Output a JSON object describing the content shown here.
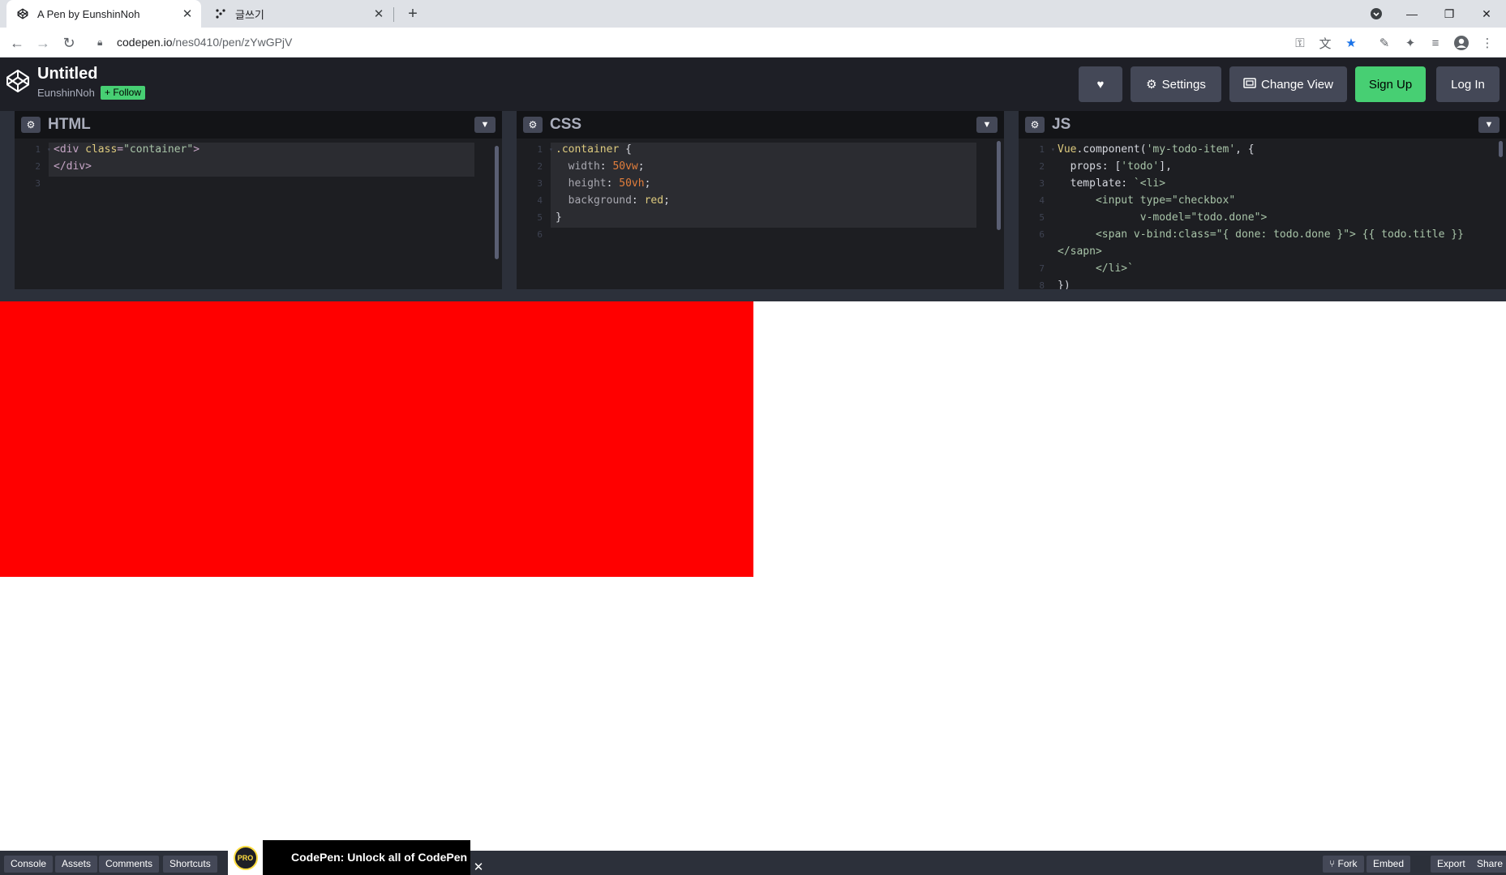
{
  "browser": {
    "tabs": [
      {
        "title": "A Pen by EunshinNoh",
        "icon": "codepen-icon",
        "active": true
      },
      {
        "title": "글쓰기",
        "icon": "dots-icon",
        "active": false
      }
    ],
    "url_host": "codepen.io",
    "url_path": "/nes0410/pen/zYwGPjV"
  },
  "header": {
    "pen_title": "Untitled",
    "author": "EunshinNoh",
    "follow_label": "+ Follow",
    "settings_label": "Settings",
    "change_view_label": "Change View",
    "sign_up_label": "Sign Up",
    "log_in_label": "Log In"
  },
  "editors": {
    "html": {
      "label": "HTML",
      "lines": [
        [
          {
            "t": "<div ",
            "c": "t-tag"
          },
          {
            "t": "class",
            "c": "t-attr"
          },
          {
            "t": "=",
            "c": "t-tag"
          },
          {
            "t": "\"container\"",
            "c": "t-str"
          },
          {
            "t": ">",
            "c": "t-tag"
          }
        ],
        [
          {
            "t": "</div>",
            "c": "t-tag"
          }
        ],
        []
      ]
    },
    "css": {
      "label": "CSS",
      "lines": [
        [
          {
            "t": ".container",
            "c": "t-sel"
          },
          {
            "t": " {",
            "c": "t-id"
          }
        ],
        [
          {
            "t": "  width",
            "c": "t-prop"
          },
          {
            "t": ": ",
            "c": "t-id"
          },
          {
            "t": "50vw",
            "c": "t-num"
          },
          {
            "t": ";",
            "c": "t-id"
          }
        ],
        [
          {
            "t": "  height",
            "c": "t-prop"
          },
          {
            "t": ": ",
            "c": "t-id"
          },
          {
            "t": "50vh",
            "c": "t-num"
          },
          {
            "t": ";",
            "c": "t-id"
          }
        ],
        [
          {
            "t": "  background",
            "c": "t-prop"
          },
          {
            "t": ": ",
            "c": "t-id"
          },
          {
            "t": "red",
            "c": "t-val"
          },
          {
            "t": ";",
            "c": "t-id"
          }
        ],
        [
          {
            "t": "}",
            "c": "t-id"
          }
        ],
        []
      ]
    },
    "js": {
      "label": "JS",
      "lines": [
        [
          {
            "t": "Vue",
            "c": "t-vue"
          },
          {
            "t": ".component(",
            "c": "t-id"
          },
          {
            "t": "'my-todo-item'",
            "c": "t-js-str"
          },
          {
            "t": ", {",
            "c": "t-id"
          }
        ],
        [
          {
            "t": "  props: [",
            "c": "t-id"
          },
          {
            "t": "'todo'",
            "c": "t-js-str"
          },
          {
            "t": "],",
            "c": "t-id"
          }
        ],
        [
          {
            "t": "  template: ",
            "c": "t-id"
          },
          {
            "t": "`<li>",
            "c": "t-js-str"
          }
        ],
        [
          {
            "t": "      <input type=\"checkbox\"",
            "c": "t-js-str"
          }
        ],
        [
          {
            "t": "             v-model=\"todo.done\">",
            "c": "t-js-str"
          }
        ],
        [
          {
            "t": "      <span v-bind:class=\"{ done: todo.done }\"> {{ todo.title }}",
            "c": "t-js-str"
          }
        ],
        [
          {
            "t": "</sapn>",
            "c": "t-js-str"
          }
        ],
        [
          {
            "t": "      </li>`",
            "c": "t-js-str"
          }
        ],
        [
          {
            "t": "})",
            "c": "t-id"
          }
        ]
      ],
      "line_numbers": [
        "1",
        "2",
        "3",
        "4",
        "5",
        "6",
        "",
        "7",
        "8"
      ]
    }
  },
  "footer": {
    "console_label": "Console",
    "assets_label": "Assets",
    "comments_label": "Comments",
    "shortcuts_label": "Shortcuts",
    "pro_badge": "PRO",
    "pro_text": "CodePen: Unlock all of CodePen",
    "fork_label": "Fork",
    "embed_label": "Embed",
    "export_label": "Export",
    "share_label": "Share"
  },
  "colors": {
    "preview_box": "#ff0000",
    "accent_green": "#47cf73",
    "header_bg": "#1e1f26"
  }
}
